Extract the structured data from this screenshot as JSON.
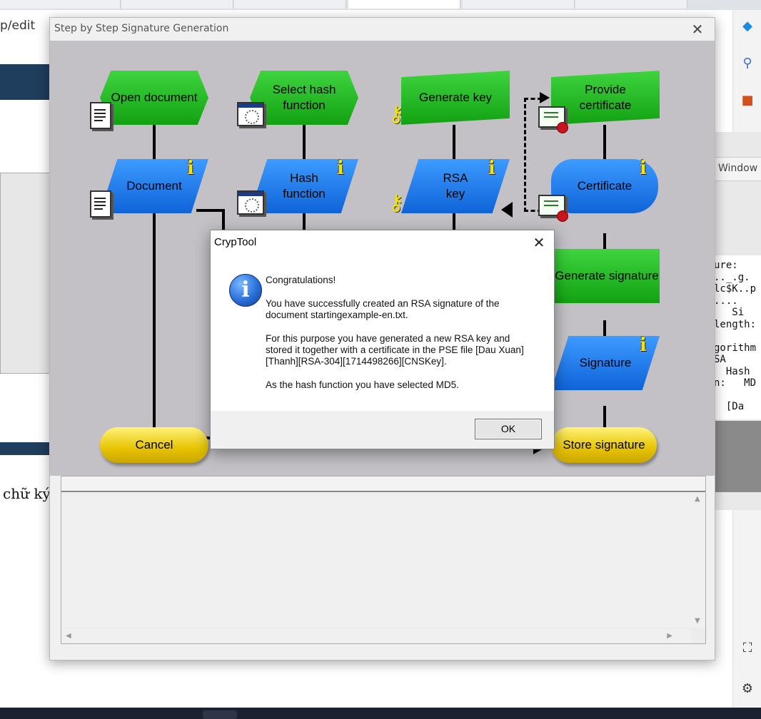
{
  "browser": {
    "address_fragment": "p/edit",
    "document_snippet": "chữ ký"
  },
  "background_window": {
    "menu_item": "Window",
    "console_lines": [
      "ure:",
      ".._.g.",
      "lc$K..p",
      "....",
      "   Si",
      "length:",
      "",
      "gorithm",
      "SA",
      "  Hash",
      "n:   MD",
      "",
      "  [Da"
    ]
  },
  "main_window": {
    "title": "Step by Step Signature Generation",
    "close_label": "✕",
    "steps": {
      "open_document": "Open document",
      "select_hash": "Select hash function",
      "generate_key": "Generate key",
      "provide_certificate": "Provide certificate",
      "document": "Document",
      "hash_function": "Hash function",
      "rsa_key": "RSA key",
      "certificate": "Certificate",
      "generate_signature": "Generate signature",
      "signature": "Signature",
      "store_signature": "Store signature",
      "cancel": "Cancel"
    },
    "info_glyph": "i"
  },
  "modal": {
    "title": "CrypTool",
    "close_label": "✕",
    "heading": "Congratulations!",
    "paragraph1": "You have successfully created an RSA signature of the document startingexample-en.txt.",
    "paragraph2": "For this purpose you have generated a new RSA key and stored it together with a certificate in the PSE file [Dau Xuan][Thanh][RSA-304][1714498266][CNSKey].",
    "paragraph3": "As the hash function you have selected MD5.",
    "ok_label": "OK",
    "icon": "info-icon"
  },
  "colors": {
    "green": "#1fb81f",
    "blue": "#1a7ef0",
    "yellow": "#f0d000",
    "flow_bg": "#c3c1c5"
  }
}
